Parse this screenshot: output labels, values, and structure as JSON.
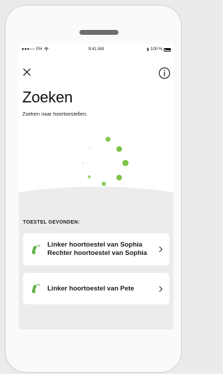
{
  "status_bar": {
    "carrier": "●●●○○ PH",
    "wifi_icon": "wifi-icon",
    "time": "9:41 AM",
    "bluetooth_icon": "bluetooth-icon",
    "battery": "100 %"
  },
  "header": {
    "close_icon": "close-icon",
    "info_icon": "info-icon",
    "title": "Zoeken",
    "subtitle": "Zoeken naar hoortoestellen."
  },
  "spinner": {
    "color": "#7cc242"
  },
  "found": {
    "section_label": "TOESTEL GEVONDEN:",
    "devices": [
      {
        "lines": [
          "Linker hoortoestel van Sophia",
          "Rechter hoortoestel van Sophia"
        ],
        "icon": "hearing-aid-icon",
        "icon_color": "#5fb246"
      },
      {
        "lines": [
          "Linker hoortoestel van Pete"
        ],
        "icon": "hearing-aid-icon",
        "icon_color": "#5fb246"
      }
    ]
  }
}
